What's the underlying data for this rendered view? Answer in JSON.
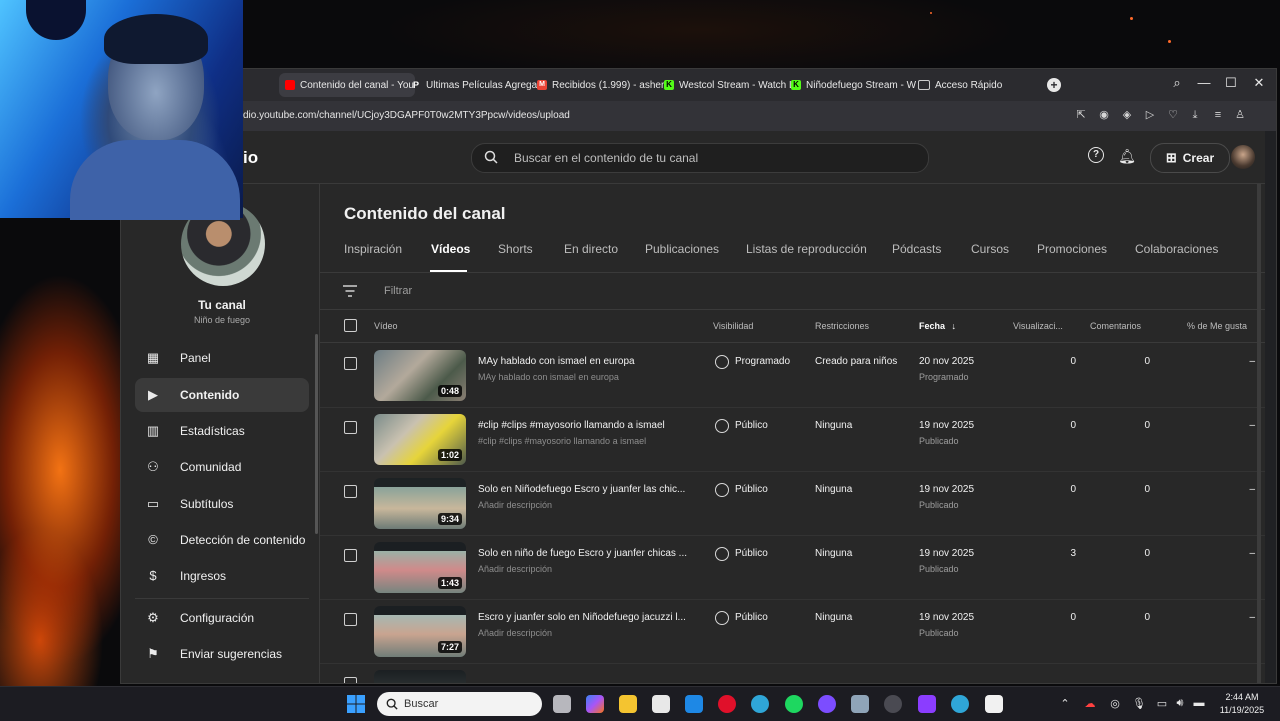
{
  "browser": {
    "tabs": [
      {
        "label": "Contenido del canal - You",
        "favicon": "youtube-icon",
        "color": "#ff0000",
        "active": true
      },
      {
        "label": "Ultimas Películas Agregad",
        "favicon": "p-icon",
        "color": "#ffffff"
      },
      {
        "label": "Recibidos (1.999) - asher.",
        "favicon": "gmail-icon",
        "color": "#ea4335"
      },
      {
        "label": "Westcol Stream - Watch L",
        "favicon": "kick-icon",
        "color": "#53fc18"
      },
      {
        "label": "Niñodefuego Stream - W",
        "favicon": "kick-icon",
        "color": "#53fc18"
      },
      {
        "label": "Acceso Rápido",
        "favicon": "grid-icon",
        "color": "#cccccc"
      }
    ],
    "url": "dio.youtube.com/channel/UCjoy3DGAPF0T0w2MTY3Ppcw/videos/upload"
  },
  "studio": {
    "logo_tail": "io",
    "search_placeholder": "Buscar en el contenido de tu canal",
    "create_label": "Crear"
  },
  "channel": {
    "name": "Tu canal",
    "subtitle": "Niño de fuego"
  },
  "sidebar": {
    "items": [
      {
        "label": "Panel",
        "icon": "dashboard-icon"
      },
      {
        "label": "Contenido",
        "icon": "content-icon",
        "active": true
      },
      {
        "label": "Estadísticas",
        "icon": "analytics-icon"
      },
      {
        "label": "Comunidad",
        "icon": "community-icon"
      },
      {
        "label": "Subtítulos",
        "icon": "subtitles-icon"
      },
      {
        "label": "Detección de contenido",
        "icon": "copyright-icon"
      },
      {
        "label": "Ingresos",
        "icon": "dollar-icon"
      }
    ],
    "bottom_items": [
      {
        "label": "Configuración",
        "icon": "gear-icon"
      },
      {
        "label": "Enviar sugerencias",
        "icon": "feedback-icon"
      }
    ]
  },
  "main": {
    "title": "Contenido del canal",
    "tabs": [
      "Inspiración",
      "Vídeos",
      "Shorts",
      "En directo",
      "Publicaciones",
      "Listas de reproducción",
      "Pódcasts",
      "Cursos",
      "Promociones",
      "Colaboraciones"
    ],
    "active_tab": "Vídeos",
    "filter_label": "Filtrar",
    "columns": {
      "video": "Vídeo",
      "visibility": "Visibilidad",
      "restrictions": "Restricciones",
      "date": "Fecha",
      "views": "Visualizaci...",
      "comments": "Comentarios",
      "likes": "% de Me gusta"
    },
    "rows": [
      {
        "title": "MAy hablado con ismael en europa",
        "desc": "MAy hablado con ismael en europa",
        "duration": "0:48",
        "visibility": "Programado",
        "vis_icon": "clock-icon",
        "restrictions": "Creado para niños",
        "date": "20 nov 2025",
        "date_status": "Programado",
        "views": "0",
        "comments": "0",
        "likes": "–"
      },
      {
        "title": "#clip #clips #mayosorio llamando a ismael",
        "desc": "#clip #clips #mayosorio llamando a ismael",
        "duration": "1:02",
        "visibility": "Público",
        "vis_icon": "globe-icon",
        "restrictions": "Ninguna",
        "date": "19 nov 2025",
        "date_status": "Publicado",
        "views": "0",
        "comments": "0",
        "likes": "–"
      },
      {
        "title": "Solo en Niñodefuego Escro y juanfer las chic...",
        "desc": "Añadir descripción",
        "duration": "9:34",
        "visibility": "Público",
        "vis_icon": "globe-icon",
        "restrictions": "Ninguna",
        "date": "19 nov 2025",
        "date_status": "Publicado",
        "views": "0",
        "comments": "0",
        "likes": "–"
      },
      {
        "title": "Solo en niño de fuego Escro y juanfer chicas ...",
        "desc": "Añadir descripción",
        "duration": "1:43",
        "visibility": "Público",
        "vis_icon": "globe-icon",
        "restrictions": "Ninguna",
        "date": "19 nov 2025",
        "date_status": "Publicado",
        "views": "3",
        "comments": "0",
        "likes": "–"
      },
      {
        "title": "Escro y juanfer solo en Niñodefuego jacuzzi l...",
        "desc": "Añadir descripción",
        "duration": "7:27",
        "visibility": "Público",
        "vis_icon": "globe-icon",
        "restrictions": "Ninguna",
        "date": "19 nov 2025",
        "date_status": "Publicado",
        "views": "0",
        "comments": "0",
        "likes": "–"
      }
    ]
  },
  "taskbar": {
    "search_placeholder": "Buscar",
    "time": "2:44 AM",
    "date": "11/19/2025"
  }
}
